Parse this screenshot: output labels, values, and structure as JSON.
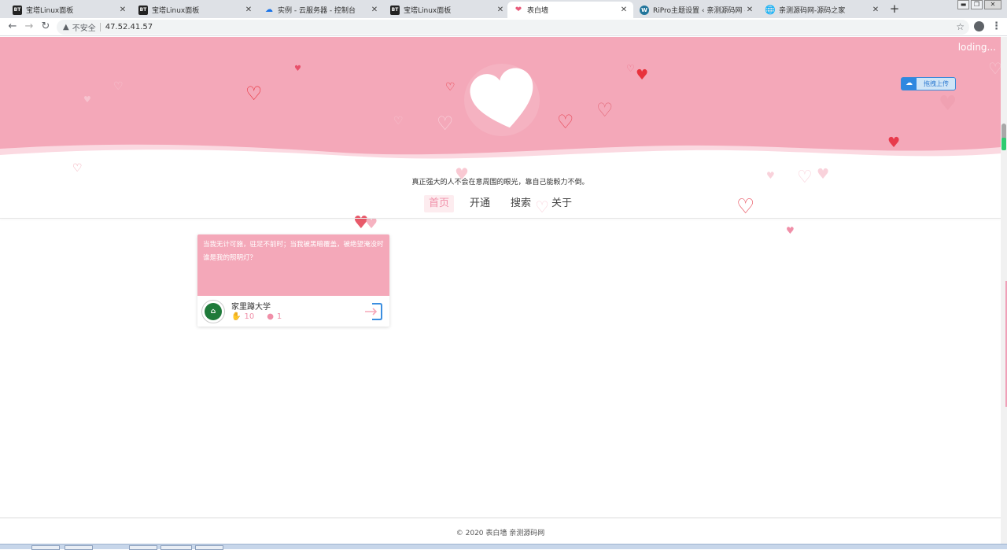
{
  "browser": {
    "tabs": [
      {
        "title": "宝塔Linux面板",
        "favicon": "bt-icon",
        "active": false
      },
      {
        "title": "宝塔Linux面板",
        "favicon": "bt-icon",
        "active": false
      },
      {
        "title": "实例 - 云服务器 - 控制台",
        "favicon": "cloud-icon",
        "active": false
      },
      {
        "title": "宝塔Linux面板",
        "favicon": "bt-icon",
        "active": false
      },
      {
        "title": "表白墙",
        "favicon": "heart-icon",
        "active": true
      },
      {
        "title": "RiPro主题设置 ‹ 亲测源码网 — W",
        "favicon": "wordpress-icon",
        "active": false
      },
      {
        "title": "亲测源码网-源码之家",
        "favicon": "globe-icon",
        "active": false
      }
    ],
    "favicon_text": "BT",
    "new_tab": "+",
    "security_label": "不安全",
    "url": "47.52.41.57"
  },
  "header": {
    "loading_text": "loding...",
    "upload_button": "拖拽上传",
    "slogan": "真正强大的人不会在意周围的眼光，靠自己能毅力不倒。"
  },
  "nav": {
    "items": [
      {
        "label": "首页",
        "active": true
      },
      {
        "label": "开通",
        "active": false
      },
      {
        "label": "搜索",
        "active": false
      },
      {
        "label": "关于",
        "active": false
      }
    ]
  },
  "posts": [
    {
      "content": "当我无计可施，驻足不前时；当我被黑暗覆盖，被绝望淹没时 谁是我的照明灯？",
      "author": "家里蹲大学",
      "likes": "10",
      "comments": "1"
    }
  ],
  "footer": {
    "text": "© 2020 表白墙  亲测源码网"
  },
  "colors": {
    "banner_pink": "#f4a8b9",
    "accent_pink": "#f08fa8",
    "heart_red": "#e8323c"
  }
}
